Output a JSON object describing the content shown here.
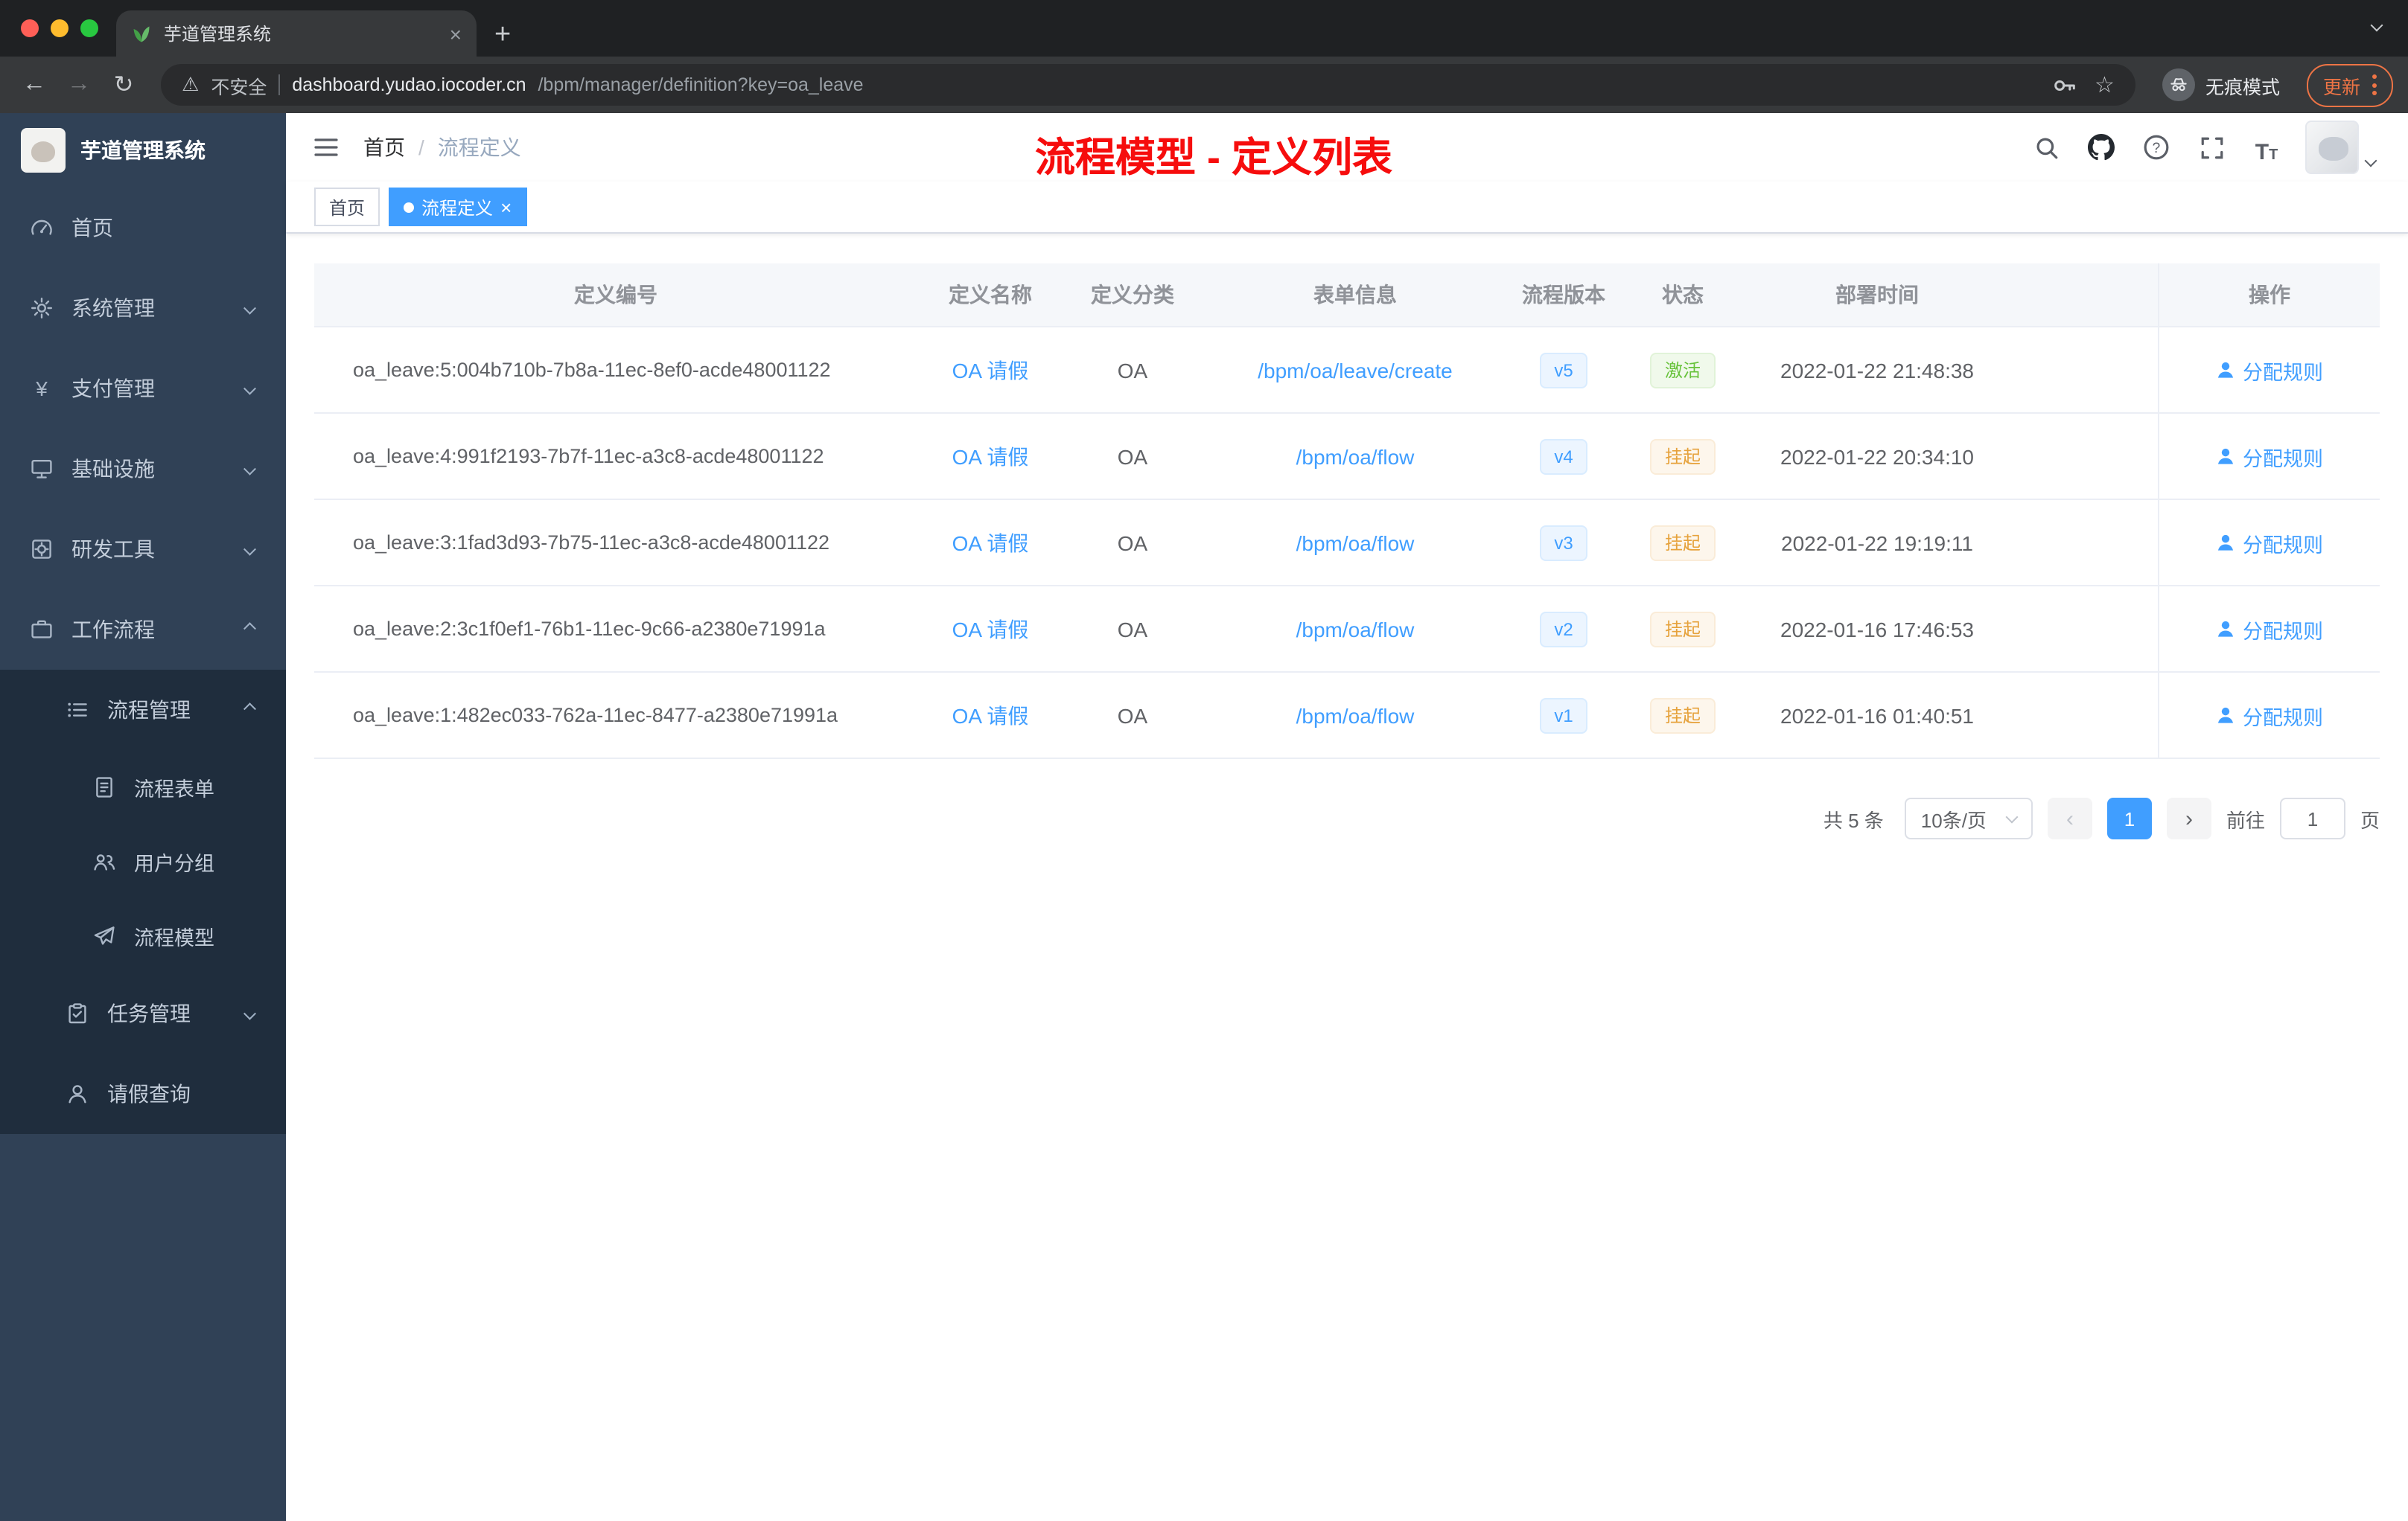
{
  "browser": {
    "tab_title": "芋道管理系统",
    "security_label": "不安全",
    "url_host": "dashboard.yudao.iocoder.cn",
    "url_path": "/bpm/manager/definition?key=oa_leave",
    "incognito_label": "无痕模式",
    "update_label": "更新"
  },
  "glyphs": {
    "close": "×",
    "plus": "+",
    "back": "←",
    "forward": "→",
    "reload": "↻",
    "warning": "⚠",
    "star": "☆",
    "breadcrumb_sep": "/",
    "question": "?",
    "font_icon": "T",
    "yen": "¥",
    "prev": "‹",
    "next": "›"
  },
  "sidebar": {
    "logo_title": "芋道管理系统",
    "items": [
      {
        "label": "首页"
      },
      {
        "label": "系统管理"
      },
      {
        "label": "支付管理"
      },
      {
        "label": "基础设施"
      },
      {
        "label": "研发工具"
      },
      {
        "label": "工作流程"
      },
      {
        "label": "流程管理"
      },
      {
        "label": "流程表单"
      },
      {
        "label": "用户分组"
      },
      {
        "label": "流程模型"
      },
      {
        "label": "任务管理"
      },
      {
        "label": "请假查询"
      }
    ]
  },
  "header": {
    "breadcrumb_home": "首页",
    "breadcrumb_current": "流程定义",
    "annotation": "流程模型 - 定义列表"
  },
  "tags": {
    "home": "首页",
    "active": "流程定义"
  },
  "table": {
    "columns": {
      "id": "定义编号",
      "name": "定义名称",
      "category": "定义分类",
      "form": "表单信息",
      "version": "流程版本",
      "status": "状态",
      "deploy": "部署时间",
      "action": "操作"
    },
    "rows": [
      {
        "id": "oa_leave:5:004b710b-7b8a-11ec-8ef0-acde48001122",
        "name": "OA 请假",
        "category": "OA",
        "form": "/bpm/oa/leave/create",
        "version": "v5",
        "status": "激活",
        "deploy_time": "2022-01-22 21:48:38",
        "action": "分配规则"
      },
      {
        "id": "oa_leave:4:991f2193-7b7f-11ec-a3c8-acde48001122",
        "name": "OA 请假",
        "category": "OA",
        "form": "/bpm/oa/flow",
        "version": "v4",
        "status": "挂起",
        "deploy_time": "2022-01-22 20:34:10",
        "action": "分配规则"
      },
      {
        "id": "oa_leave:3:1fad3d93-7b75-11ec-a3c8-acde48001122",
        "name": "OA 请假",
        "category": "OA",
        "form": "/bpm/oa/flow",
        "version": "v3",
        "status": "挂起",
        "deploy_time": "2022-01-22 19:19:11",
        "action": "分配规则"
      },
      {
        "id": "oa_leave:2:3c1f0ef1-76b1-11ec-9c66-a2380e71991a",
        "name": "OA 请假",
        "category": "OA",
        "form": "/bpm/oa/flow",
        "version": "v2",
        "status": "挂起",
        "deploy_time": "2022-01-16 17:46:53",
        "action": "分配规则"
      },
      {
        "id": "oa_leave:1:482ec033-762a-11ec-8477-a2380e71991a",
        "name": "OA 请假",
        "category": "OA",
        "form": "/bpm/oa/flow",
        "version": "v1",
        "status": "挂起",
        "deploy_time": "2022-01-16 01:40:51",
        "action": "分配规则"
      }
    ]
  },
  "pagination": {
    "total": "共 5 条",
    "page_size": "10条/页",
    "current_page": "1",
    "goto_label": "前往",
    "goto_value": "1",
    "unit_label": "页"
  },
  "colors": {
    "accent": "#409eff",
    "success": "#67c23a",
    "warning": "#e6a23c",
    "annotation_red": "#f60d0d",
    "sidebar_bg": "#304156",
    "submenu_bg": "#1f2d3d"
  }
}
